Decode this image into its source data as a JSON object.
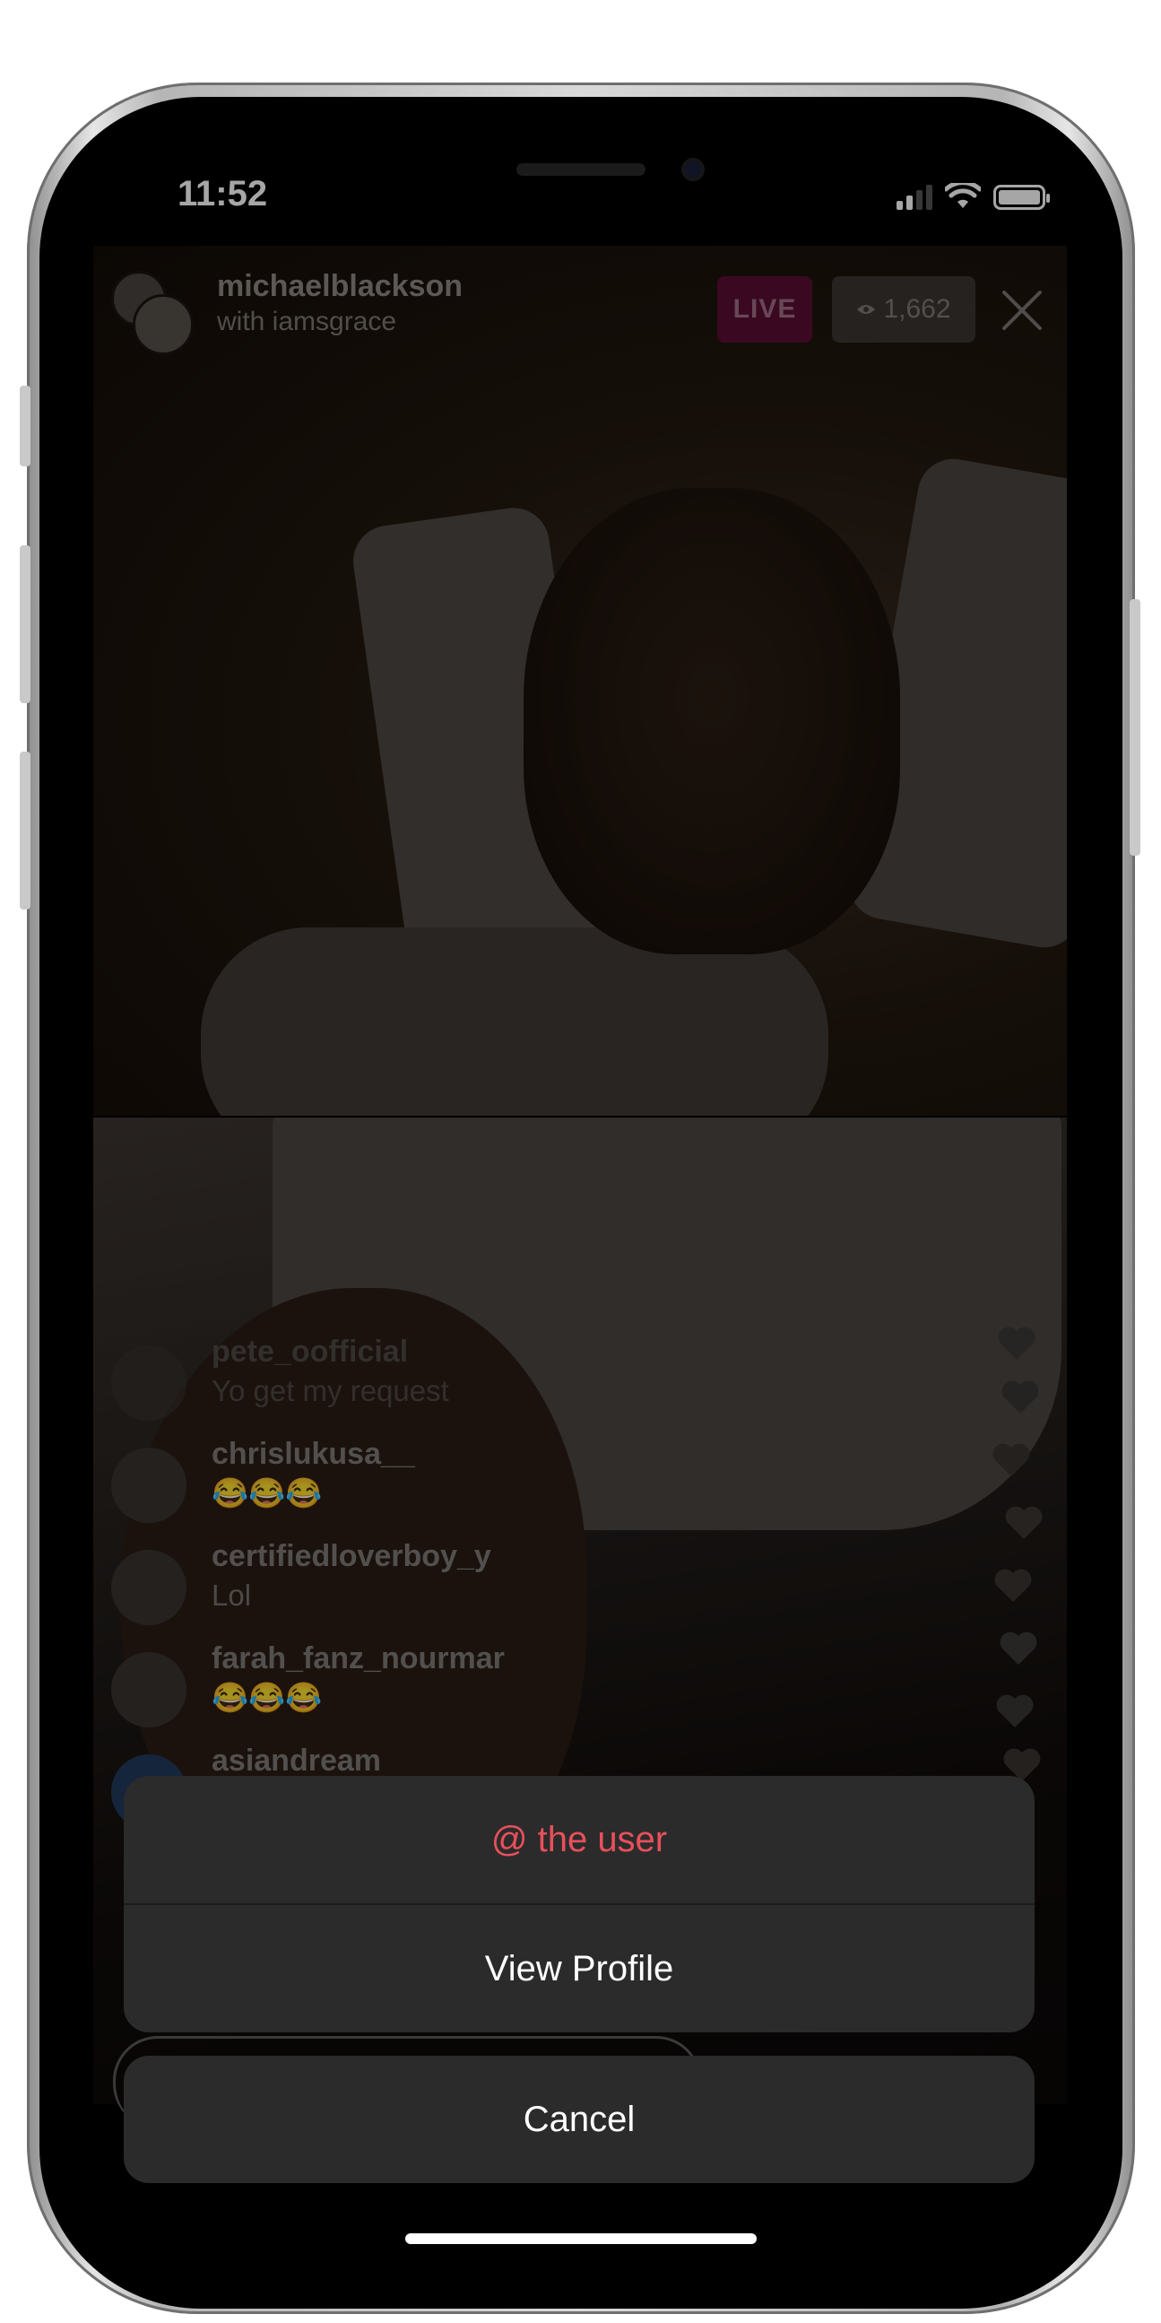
{
  "status_bar": {
    "time": "11:52"
  },
  "live": {
    "host_username": "michaelblackson",
    "with_text": "with iamsgrace",
    "live_label": "LIVE",
    "viewer_count": "1,662"
  },
  "comments": [
    {
      "username": "pete_oofficial",
      "text": "Yo get my request"
    },
    {
      "username": "chrislukusa__",
      "text": "😂😂😂"
    },
    {
      "username": "certifiedloverboy_y",
      "text": "Lol"
    },
    {
      "username": "farah_fanz_nourmar",
      "text": "😂😂😂"
    },
    {
      "username": "asiandream",
      "text": ""
    }
  ],
  "action_sheet": {
    "mention_label": "@ the user",
    "view_profile_label": "View Profile",
    "cancel_label": "Cancel"
  },
  "colors": {
    "mention_accent": "#e8505b",
    "live_badge": "#5a0f33",
    "sheet_bg": "#2b2b2b"
  },
  "icons": [
    "signal-icon",
    "wifi-icon",
    "battery-icon",
    "eye-icon",
    "close-icon",
    "heart-icon"
  ]
}
